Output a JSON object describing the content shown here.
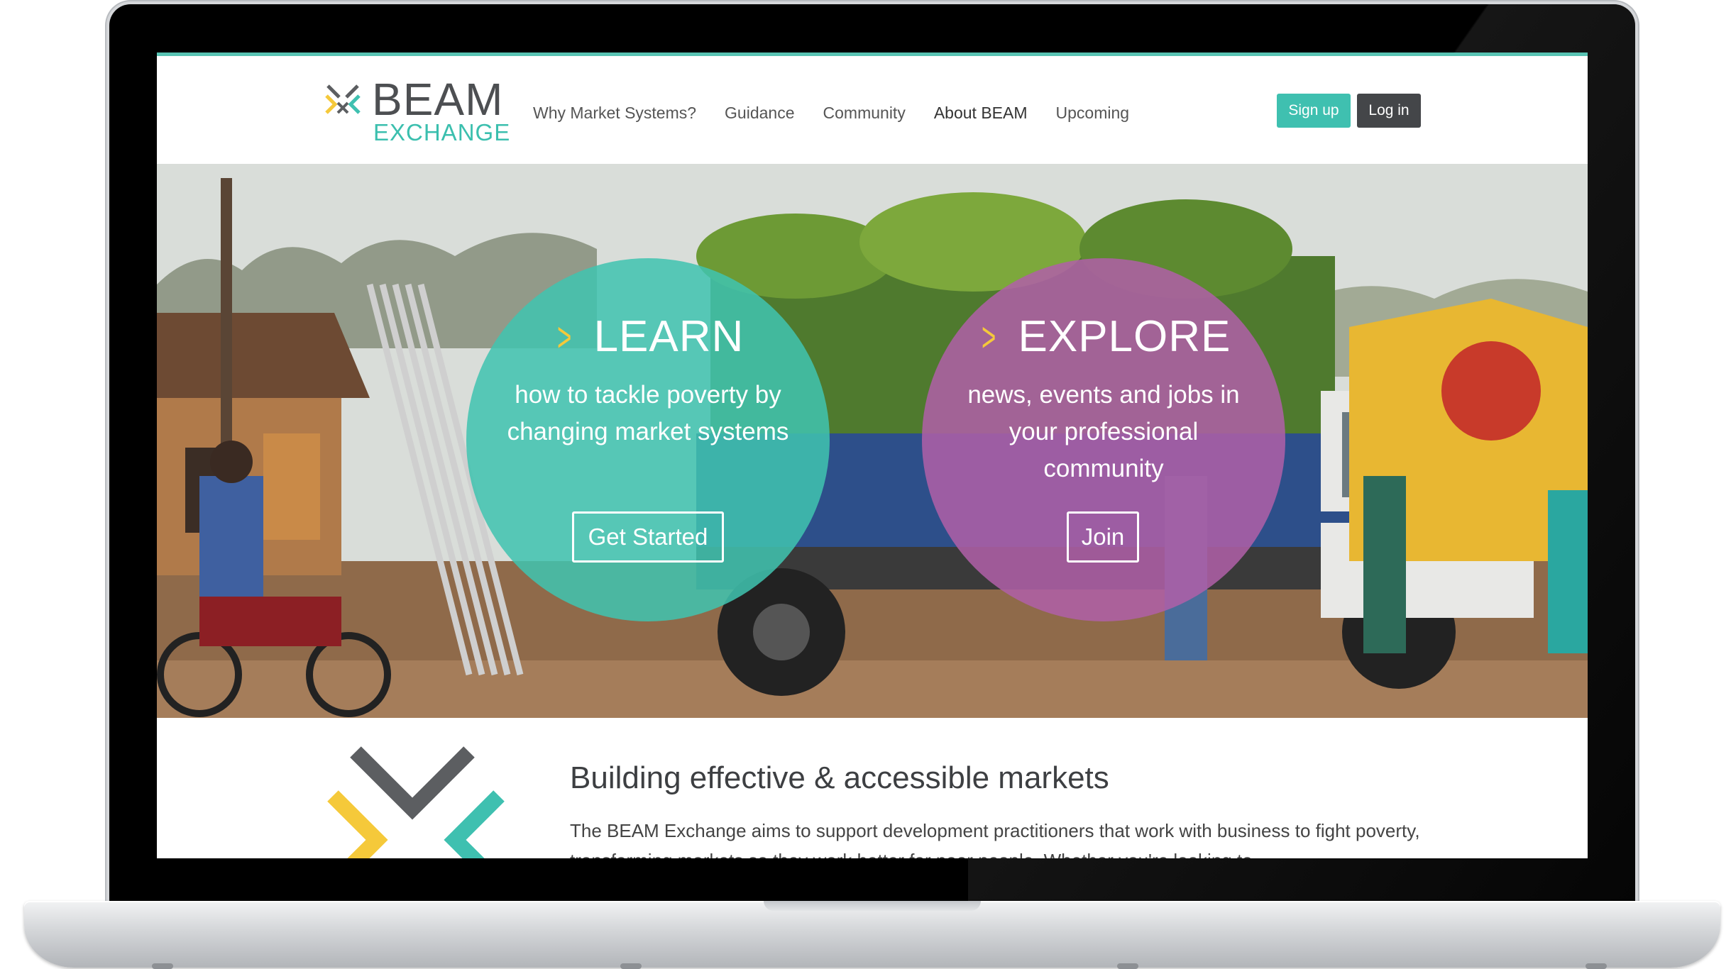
{
  "logo": {
    "word": "BEAM",
    "sub": "EXCHANGE"
  },
  "nav": {
    "items": [
      {
        "label": "Why Market Systems?"
      },
      {
        "label": "Guidance"
      },
      {
        "label": "Community"
      },
      {
        "label": "About BEAM"
      },
      {
        "label": "Upcoming"
      }
    ]
  },
  "auth": {
    "signup_label": "Sign up",
    "login_label": "Log in"
  },
  "hero": {
    "learn": {
      "title": "LEARN",
      "text": "how to tackle poverty by changing market systems",
      "button": "Get Started"
    },
    "explore": {
      "title": "EXPLORE",
      "text": "news, events and jobs in your professional community",
      "button": "Join"
    }
  },
  "intro": {
    "title": "Building effective & accessible markets",
    "text": "The BEAM Exchange aims to support development practitioners that work with business to fight poverty, transforming markets so they work better for poor people. Whether you're looking to"
  },
  "colors": {
    "teal": "#3fc0b0",
    "purple": "#b060a8",
    "yellow": "#f5c93a",
    "dark": "#444649"
  },
  "icons": {
    "chevron": "chevron-right-icon",
    "logo_mark": "beam-x-icon"
  }
}
